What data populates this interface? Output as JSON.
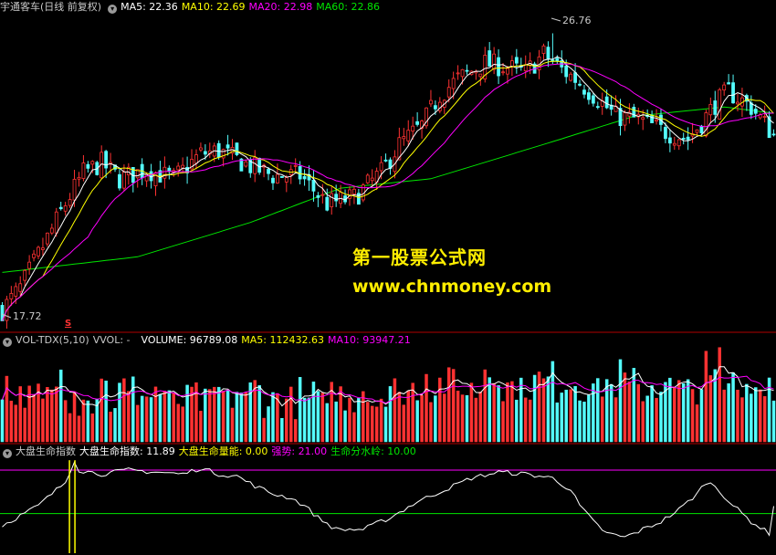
{
  "price_header": {
    "title": "宇通客车(日线 前复权)",
    "ma5": "MA5: 22.36",
    "ma10": "MA10: 22.69",
    "ma20": "MA20: 22.98",
    "ma60": "MA60: 22.86"
  },
  "volume_header": {
    "title": "VOL-TDX(5,10)",
    "vvol": "VVOL: -",
    "volume": "VOLUME: 96789.08",
    "ma5": "MA5: 112432.63",
    "ma10": "MA10: 93947.21"
  },
  "indicator_header": {
    "title": "大盘生命指数",
    "index": "大盘生命指数: 11.89",
    "energy": "大盘生命量能: 0.00",
    "strong": "强势: 21.00",
    "divide": "生命分水岭: 10.00"
  },
  "annotations": {
    "high": "26.76",
    "low": "17.72",
    "marker": "S"
  },
  "watermark": {
    "line1": "第一股票公式网",
    "line2": "www.chnmoney.com"
  },
  "colors": {
    "up": "#ff3232",
    "down": "#54fcfc",
    "ma5": "#ffffff",
    "ma10": "#ffff00",
    "ma20": "#ff00ff",
    "ma60": "#00e600",
    "strong_line": "#ff00ff",
    "divide_line": "#00e600",
    "separator": "#b00000"
  },
  "chart_data": {
    "type": "candlestick",
    "series_source": "synthetic-trend",
    "price": {
      "low_mark": 17.72,
      "high_mark": 26.76,
      "ylim": [
        17.3,
        27.3
      ],
      "anchors": [
        [
          0,
          17.9
        ],
        [
          4,
          18.6
        ],
        [
          10,
          20.2
        ],
        [
          14,
          21.3
        ],
        [
          18,
          22.3
        ],
        [
          22,
          22.6
        ],
        [
          26,
          22.1
        ],
        [
          32,
          22.4
        ],
        [
          38,
          22.1
        ],
        [
          44,
          22.9
        ],
        [
          48,
          23.0
        ],
        [
          55,
          22.5
        ],
        [
          60,
          22.2
        ],
        [
          66,
          22.2
        ],
        [
          72,
          21.3
        ],
        [
          78,
          21.5
        ],
        [
          84,
          22.3
        ],
        [
          88,
          23.2
        ],
        [
          93,
          23.8
        ],
        [
          97,
          24.8
        ],
        [
          101,
          25.3
        ],
        [
          107,
          25.8
        ],
        [
          111,
          25.7
        ],
        [
          116,
          25.5
        ],
        [
          120,
          26.1
        ],
        [
          124,
          25.6
        ],
        [
          127,
          25.3
        ],
        [
          131,
          24.8
        ],
        [
          136,
          24.1
        ],
        [
          141,
          24.0
        ],
        [
          147,
          23.6
        ],
        [
          152,
          23.4
        ],
        [
          155,
          23.9
        ],
        [
          158,
          24.5
        ],
        [
          161,
          24.9
        ],
        [
          166,
          24.4
        ],
        [
          171,
          23.5
        ]
      ],
      "ma60_anchors": [
        [
          0,
          19.1
        ],
        [
          30,
          19.6
        ],
        [
          55,
          20.7
        ],
        [
          75,
          21.8
        ],
        [
          95,
          22.1
        ],
        [
          120,
          23.2
        ],
        [
          140,
          24.1
        ],
        [
          160,
          24.4
        ],
        [
          171,
          24.2
        ]
      ],
      "mas": [
        "MA5",
        "MA10",
        "MA20",
        "MA60"
      ]
    },
    "volume": {
      "ylim": [
        0,
        220000
      ],
      "last": 96789.08,
      "ma5_last": 112432.63,
      "ma10_last": 93947.21
    },
    "indicator": {
      "ylim": [
        0,
        24
      ],
      "strong": 21,
      "divide": 10,
      "last": 11.89,
      "anchors": [
        [
          0,
          7
        ],
        [
          8,
          12
        ],
        [
          14,
          18
        ],
        [
          16,
          23.5
        ],
        [
          17,
          21
        ],
        [
          22,
          20
        ],
        [
          28,
          21
        ],
        [
          34,
          20.5
        ],
        [
          40,
          20
        ],
        [
          44,
          21.5
        ],
        [
          48,
          20
        ],
        [
          52,
          19.5
        ],
        [
          56,
          17
        ],
        [
          60,
          15
        ],
        [
          64,
          14
        ],
        [
          67,
          12
        ],
        [
          70,
          9
        ],
        [
          74,
          6
        ],
        [
          80,
          6
        ],
        [
          86,
          9
        ],
        [
          92,
          13
        ],
        [
          98,
          16
        ],
        [
          104,
          19
        ],
        [
          110,
          20.5
        ],
        [
          116,
          20
        ],
        [
          122,
          19
        ],
        [
          126,
          16
        ],
        [
          128,
          12
        ],
        [
          131,
          8
        ],
        [
          134,
          5
        ],
        [
          138,
          4
        ],
        [
          142,
          6
        ],
        [
          146,
          8
        ],
        [
          150,
          11
        ],
        [
          154,
          15
        ],
        [
          156,
          18
        ],
        [
          158,
          17
        ],
        [
          162,
          12
        ],
        [
          166,
          8
        ],
        [
          170,
          5
        ]
      ]
    }
  }
}
